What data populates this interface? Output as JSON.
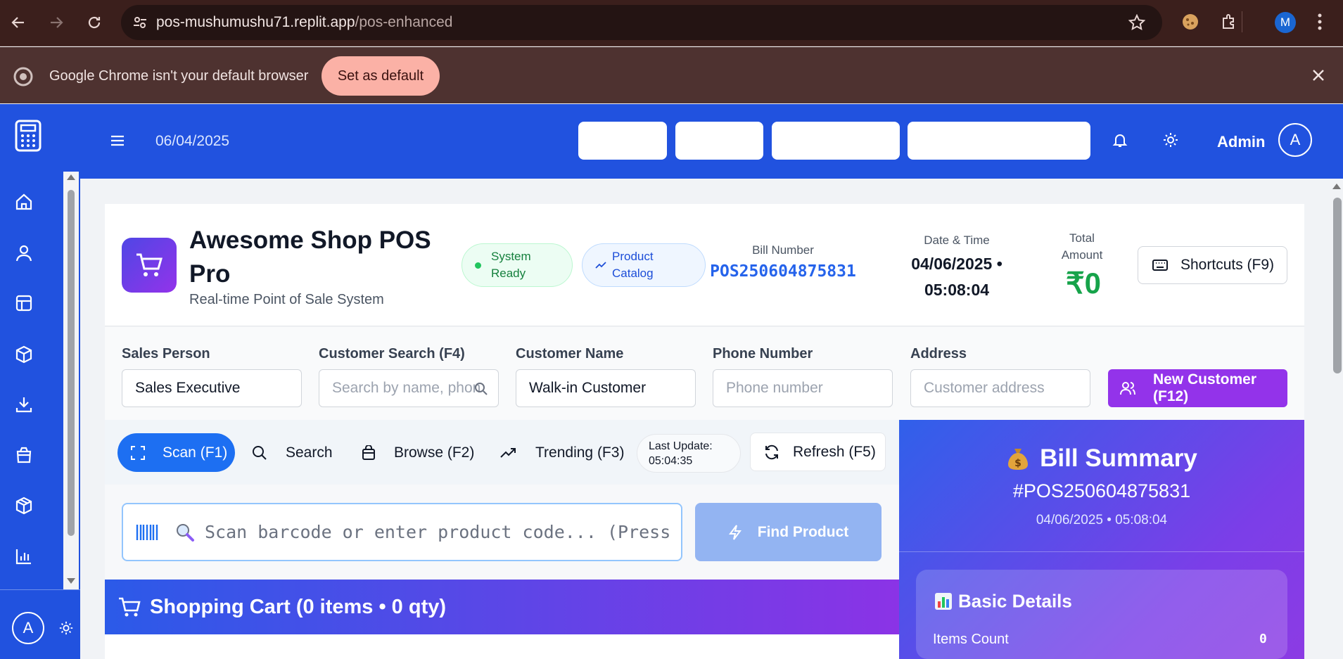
{
  "browser": {
    "url_host": "pos-mushumushu71.replit.app",
    "url_path": "/pos-enhanced",
    "profile_initial": "M",
    "infobar_text": "Google Chrome isn't your default browser",
    "set_default_label": "Set as default"
  },
  "header": {
    "date": "06/04/2025",
    "user_name": "Admin",
    "user_initial": "A"
  },
  "sidebar": {
    "items": [
      "home-icon",
      "user-icon",
      "layout-icon",
      "box-icon",
      "download-icon",
      "shopping-bag-icon",
      "package-icon",
      "bar-chart-icon"
    ],
    "user_initial": "A"
  },
  "shop": {
    "title": "Awesome Shop POS Pro",
    "subtitle": "Real-time Point of Sale System",
    "status_pill": "System Ready",
    "catalog_pill": "Product Catalog",
    "bill_number_label": "Bill Number",
    "bill_number": "POS250604875831",
    "datetime_label": "Date & Time",
    "datetime_value": "04/06/2025 • 05:08:04",
    "total_label": "Total Amount",
    "total_value": "₹0",
    "shortcuts_label": "Shortcuts (F9)"
  },
  "form": {
    "sales_person_label": "Sales Person",
    "sales_person_value": "Sales Executive",
    "customer_search_label": "Customer Search (F4)",
    "customer_search_placeholder": "Search by name, phone",
    "customer_name_label": "Customer Name",
    "customer_name_value": "Walk-in Customer",
    "phone_label": "Phone Number",
    "phone_placeholder": "Phone number",
    "address_label": "Address",
    "address_placeholder": "Customer address",
    "new_customer_label": "New Customer (F12)"
  },
  "tabs": {
    "scan": "Scan (F1)",
    "search": "Search",
    "browse": "Browse (F2)",
    "trending": "Trending (F3)",
    "last_update_label": "Last Update:",
    "last_update_value": "05:04:35",
    "refresh": "Refresh (F5)"
  },
  "scan": {
    "placeholder": "Scan barcode or enter product code... (Press",
    "find_label": "Find Product"
  },
  "cart": {
    "title": "Shopping Cart (0 items • 0 qty)"
  },
  "summary": {
    "title": "Bill Summary",
    "bill_no": "#POS250604875831",
    "datetime": "04/06/2025 • 05:08:04",
    "basic_title": "Basic Details",
    "items_count_label": "Items Count",
    "items_count_value": "0"
  },
  "colors": {
    "header_blue": "#2152df",
    "chrome_brown": "#3b1f1c",
    "accent_purple": "#9333ea",
    "total_green": "#16a34a"
  }
}
